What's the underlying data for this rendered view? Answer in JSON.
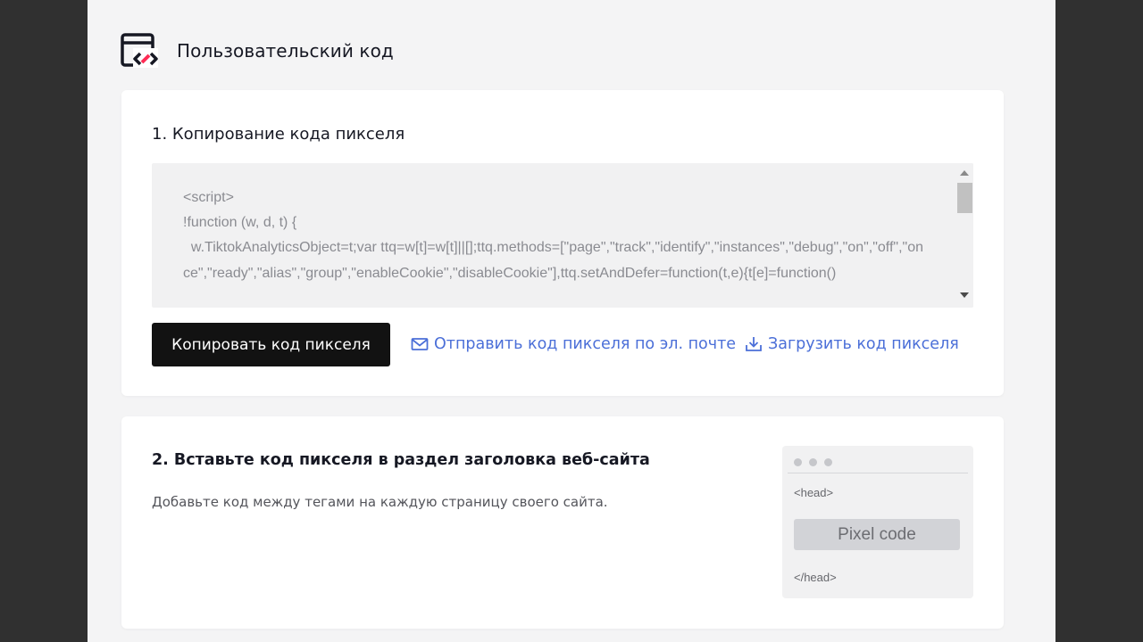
{
  "header": {
    "title": "Пользовательский код",
    "icon": "custom-code-icon"
  },
  "step1": {
    "title": "1. Копирование кода пикселя",
    "code_snippet": "<script>\n!function (w, d, t) {\n  w.TiktokAnalyticsObject=t;var ttq=w[t]=w[t]||[];ttq.methods=[\"page\",\"track\",\"identify\",\"instances\",\"debug\",\"on\",\"off\",\"once\",\"ready\",\"alias\",\"group\",\"enableCookie\",\"disableCookie\"],ttq.setAndDefer=function(t,e){t[e]=function()",
    "copy_button_label": "Копировать код пикселя",
    "email_link_label": "Отправить код пикселя по эл. почте",
    "email_icon": "mail-icon",
    "download_link_label": "Загрузить код пикселя",
    "download_icon": "download-icon"
  },
  "step2": {
    "title": "2. Вставьте код пикселя в раздел заголовка веб-сайта",
    "description": "Добавьте код между тегами на каждую страницу своего сайта.",
    "preview": {
      "head_open": "<head>",
      "pixel_code": "Pixel code",
      "head_close": "</head>"
    }
  },
  "colors": {
    "accent_link": "#4b6fd8",
    "primary_button": "#121212",
    "icon_red": "#fe2c55"
  }
}
